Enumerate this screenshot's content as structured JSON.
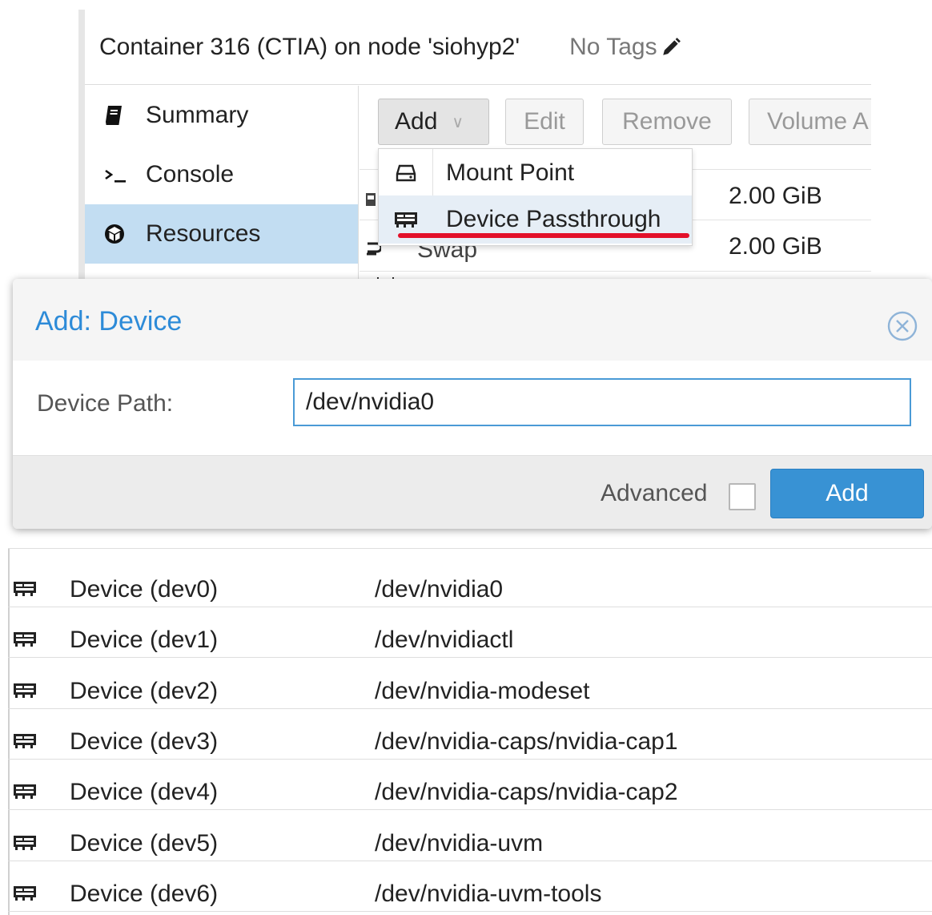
{
  "header": {
    "title": "Container 316 (CTIA) on node 'siohyp2'",
    "tags": "No Tags"
  },
  "nav": {
    "items": [
      {
        "label": "Summary",
        "icon": "book-icon"
      },
      {
        "label": "Console",
        "icon": "terminal-icon"
      },
      {
        "label": "Resources",
        "icon": "cube-icon",
        "active": true
      }
    ]
  },
  "toolbar": {
    "add": "Add",
    "edit": "Edit",
    "remove": "Remove",
    "volume": "Volume A"
  },
  "resources": {
    "rows": [
      {
        "value": "2.00 GiB"
      },
      {
        "name": "Swap",
        "value": "2.00 GiB"
      }
    ]
  },
  "menu": {
    "items": [
      {
        "label": "Mount Point",
        "icon": "hdd-icon"
      },
      {
        "label": "Device Passthrough",
        "icon": "device-card-icon",
        "hover": true
      }
    ]
  },
  "dialog": {
    "title": "Add: Device",
    "device_path_label": "Device Path:",
    "device_path_value": "/dev/nvidia0",
    "advanced_label": "Advanced",
    "add_button": "Add"
  },
  "devices": [
    {
      "name": "Device (dev0)",
      "path": "/dev/nvidia0"
    },
    {
      "name": "Device (dev1)",
      "path": "/dev/nvidiactl"
    },
    {
      "name": "Device (dev2)",
      "path": "/dev/nvidia-modeset"
    },
    {
      "name": "Device (dev3)",
      "path": "/dev/nvidia-caps/nvidia-cap1"
    },
    {
      "name": "Device (dev4)",
      "path": "/dev/nvidia-caps/nvidia-cap2"
    },
    {
      "name": "Device (dev5)",
      "path": "/dev/nvidia-uvm"
    },
    {
      "name": "Device (dev6)",
      "path": "/dev/nvidia-uvm-tools"
    }
  ],
  "colors": {
    "accent": "#2d8bd8",
    "primary_button": "#3892d4",
    "nav_active": "#c2ddf2",
    "highlight_underline": "#e3102a"
  }
}
